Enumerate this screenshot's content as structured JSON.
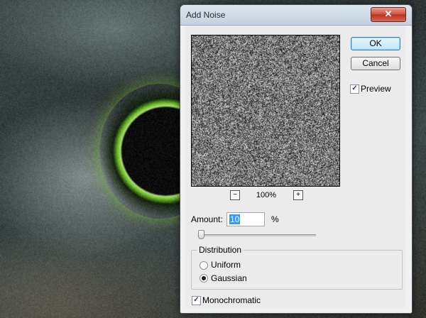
{
  "window": {
    "title": "Add Noise",
    "close_glyph": "✕"
  },
  "buttons": {
    "ok": "OK",
    "cancel": "Cancel"
  },
  "preview": {
    "checkbox_label": "Preview",
    "checked": true,
    "zoom": "100%",
    "zoom_out": "−",
    "zoom_in": "+"
  },
  "amount": {
    "label": "Amount:",
    "value": "10",
    "unit": "%",
    "slider_fraction": 0.025
  },
  "distribution": {
    "label": "Distribution",
    "options": [
      "Uniform",
      "Gaussian"
    ],
    "selected": "Gaussian"
  },
  "monochromatic": {
    "label": "Monochromatic",
    "checked": true
  },
  "colors": {
    "ok_border": "#3c7fb1",
    "close_red": "#cf4b37",
    "glow_green": "#6ccc1c"
  }
}
